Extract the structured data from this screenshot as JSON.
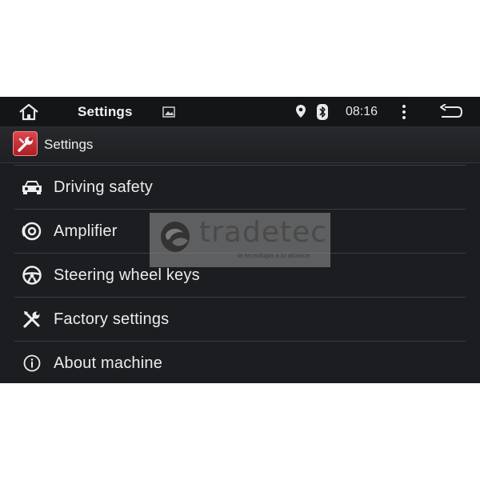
{
  "status_bar": {
    "title": "Settings",
    "time": "08:16",
    "icons": [
      "home-icon",
      "image-icon",
      "location-icon",
      "bluetooth-icon",
      "overflow-menu-icon",
      "back-icon"
    ]
  },
  "app_bar": {
    "title": "Settings",
    "icon": "settings-wrench-icon"
  },
  "menu": {
    "items": [
      {
        "label": "Driving safety",
        "icon": "car-icon"
      },
      {
        "label": "Amplifier",
        "icon": "speaker-icon"
      },
      {
        "label": "Steering wheel keys",
        "icon": "steering-wheel-icon"
      },
      {
        "label": "Factory settings",
        "icon": "tools-icon"
      },
      {
        "label": "About machine",
        "icon": "info-icon"
      }
    ]
  },
  "watermark": {
    "name": "tradetec",
    "tagline": "la tecnologia a tu alcance"
  },
  "colors": {
    "background": "#1b1d20",
    "status_bar": "#141517",
    "divider": "#3b3d41",
    "text": "#ececec",
    "app_icon": "#c62f35"
  }
}
